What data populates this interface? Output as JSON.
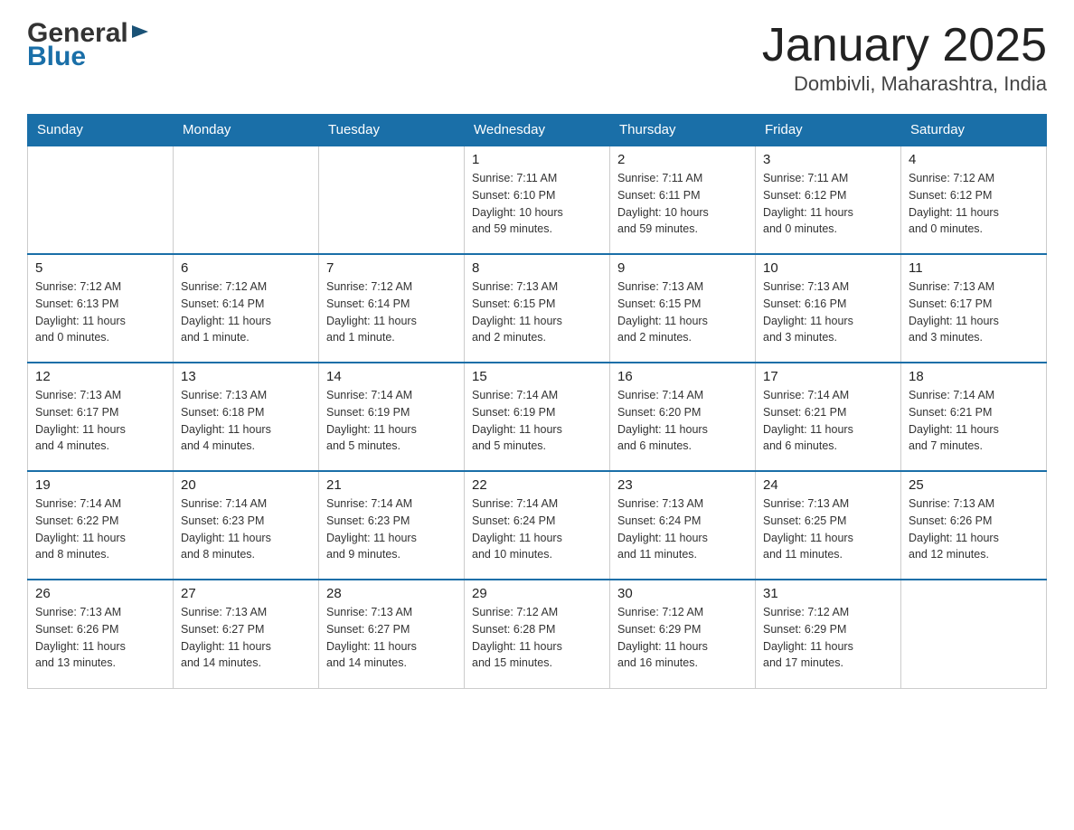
{
  "header": {
    "logo_general": "General",
    "logo_blue": "Blue",
    "title": "January 2025",
    "subtitle": "Dombivli, Maharashtra, India"
  },
  "weekdays": [
    "Sunday",
    "Monday",
    "Tuesday",
    "Wednesday",
    "Thursday",
    "Friday",
    "Saturday"
  ],
  "weeks": [
    [
      {
        "day": "",
        "info": ""
      },
      {
        "day": "",
        "info": ""
      },
      {
        "day": "",
        "info": ""
      },
      {
        "day": "1",
        "info": "Sunrise: 7:11 AM\nSunset: 6:10 PM\nDaylight: 10 hours\nand 59 minutes."
      },
      {
        "day": "2",
        "info": "Sunrise: 7:11 AM\nSunset: 6:11 PM\nDaylight: 10 hours\nand 59 minutes."
      },
      {
        "day": "3",
        "info": "Sunrise: 7:11 AM\nSunset: 6:12 PM\nDaylight: 11 hours\nand 0 minutes."
      },
      {
        "day": "4",
        "info": "Sunrise: 7:12 AM\nSunset: 6:12 PM\nDaylight: 11 hours\nand 0 minutes."
      }
    ],
    [
      {
        "day": "5",
        "info": "Sunrise: 7:12 AM\nSunset: 6:13 PM\nDaylight: 11 hours\nand 0 minutes."
      },
      {
        "day": "6",
        "info": "Sunrise: 7:12 AM\nSunset: 6:14 PM\nDaylight: 11 hours\nand 1 minute."
      },
      {
        "day": "7",
        "info": "Sunrise: 7:12 AM\nSunset: 6:14 PM\nDaylight: 11 hours\nand 1 minute."
      },
      {
        "day": "8",
        "info": "Sunrise: 7:13 AM\nSunset: 6:15 PM\nDaylight: 11 hours\nand 2 minutes."
      },
      {
        "day": "9",
        "info": "Sunrise: 7:13 AM\nSunset: 6:15 PM\nDaylight: 11 hours\nand 2 minutes."
      },
      {
        "day": "10",
        "info": "Sunrise: 7:13 AM\nSunset: 6:16 PM\nDaylight: 11 hours\nand 3 minutes."
      },
      {
        "day": "11",
        "info": "Sunrise: 7:13 AM\nSunset: 6:17 PM\nDaylight: 11 hours\nand 3 minutes."
      }
    ],
    [
      {
        "day": "12",
        "info": "Sunrise: 7:13 AM\nSunset: 6:17 PM\nDaylight: 11 hours\nand 4 minutes."
      },
      {
        "day": "13",
        "info": "Sunrise: 7:13 AM\nSunset: 6:18 PM\nDaylight: 11 hours\nand 4 minutes."
      },
      {
        "day": "14",
        "info": "Sunrise: 7:14 AM\nSunset: 6:19 PM\nDaylight: 11 hours\nand 5 minutes."
      },
      {
        "day": "15",
        "info": "Sunrise: 7:14 AM\nSunset: 6:19 PM\nDaylight: 11 hours\nand 5 minutes."
      },
      {
        "day": "16",
        "info": "Sunrise: 7:14 AM\nSunset: 6:20 PM\nDaylight: 11 hours\nand 6 minutes."
      },
      {
        "day": "17",
        "info": "Sunrise: 7:14 AM\nSunset: 6:21 PM\nDaylight: 11 hours\nand 6 minutes."
      },
      {
        "day": "18",
        "info": "Sunrise: 7:14 AM\nSunset: 6:21 PM\nDaylight: 11 hours\nand 7 minutes."
      }
    ],
    [
      {
        "day": "19",
        "info": "Sunrise: 7:14 AM\nSunset: 6:22 PM\nDaylight: 11 hours\nand 8 minutes."
      },
      {
        "day": "20",
        "info": "Sunrise: 7:14 AM\nSunset: 6:23 PM\nDaylight: 11 hours\nand 8 minutes."
      },
      {
        "day": "21",
        "info": "Sunrise: 7:14 AM\nSunset: 6:23 PM\nDaylight: 11 hours\nand 9 minutes."
      },
      {
        "day": "22",
        "info": "Sunrise: 7:14 AM\nSunset: 6:24 PM\nDaylight: 11 hours\nand 10 minutes."
      },
      {
        "day": "23",
        "info": "Sunrise: 7:13 AM\nSunset: 6:24 PM\nDaylight: 11 hours\nand 11 minutes."
      },
      {
        "day": "24",
        "info": "Sunrise: 7:13 AM\nSunset: 6:25 PM\nDaylight: 11 hours\nand 11 minutes."
      },
      {
        "day": "25",
        "info": "Sunrise: 7:13 AM\nSunset: 6:26 PM\nDaylight: 11 hours\nand 12 minutes."
      }
    ],
    [
      {
        "day": "26",
        "info": "Sunrise: 7:13 AM\nSunset: 6:26 PM\nDaylight: 11 hours\nand 13 minutes."
      },
      {
        "day": "27",
        "info": "Sunrise: 7:13 AM\nSunset: 6:27 PM\nDaylight: 11 hours\nand 14 minutes."
      },
      {
        "day": "28",
        "info": "Sunrise: 7:13 AM\nSunset: 6:27 PM\nDaylight: 11 hours\nand 14 minutes."
      },
      {
        "day": "29",
        "info": "Sunrise: 7:12 AM\nSunset: 6:28 PM\nDaylight: 11 hours\nand 15 minutes."
      },
      {
        "day": "30",
        "info": "Sunrise: 7:12 AM\nSunset: 6:29 PM\nDaylight: 11 hours\nand 16 minutes."
      },
      {
        "day": "31",
        "info": "Sunrise: 7:12 AM\nSunset: 6:29 PM\nDaylight: 11 hours\nand 17 minutes."
      },
      {
        "day": "",
        "info": ""
      }
    ]
  ]
}
